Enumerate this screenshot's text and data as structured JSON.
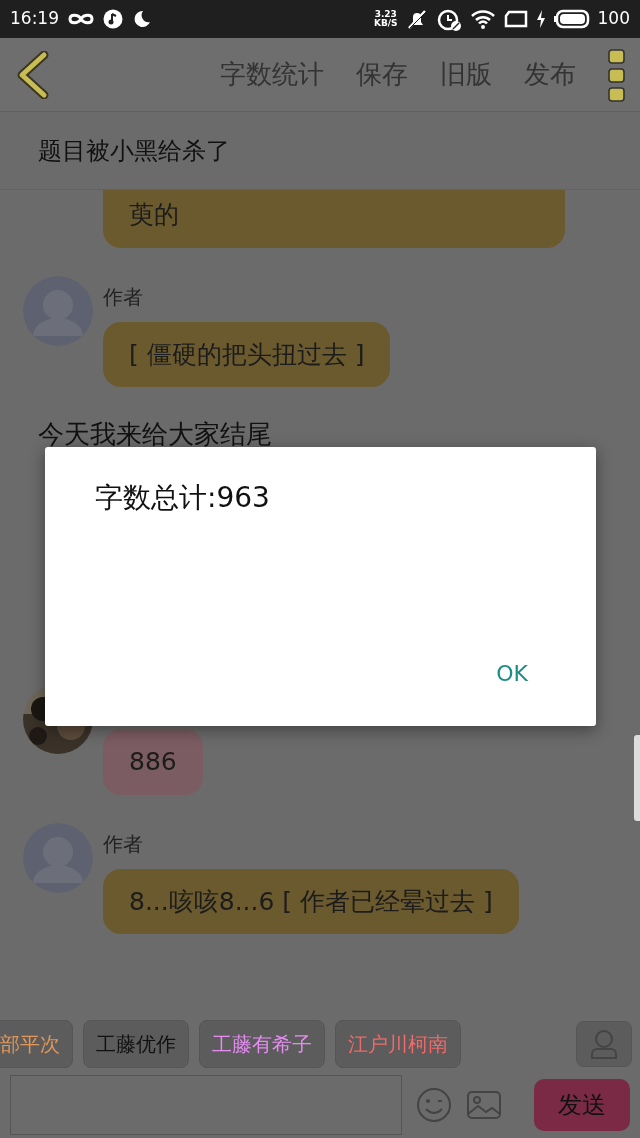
{
  "status_bar": {
    "time": "16:19",
    "speed": "3.23",
    "speed_unit": "KB/S",
    "battery": "100"
  },
  "toolbar": {
    "actions": [
      {
        "label": "字数统计"
      },
      {
        "label": "保存"
      },
      {
        "label": "旧版"
      },
      {
        "label": "发布"
      }
    ]
  },
  "title": "题目被小黑给杀了",
  "messages": [
    {
      "kind": "continued",
      "text": "萸的",
      "color": "#6b5a2e"
    },
    {
      "kind": "default_avatar",
      "name": "作者",
      "text": "[ 僵硬的把头扭过去 ]",
      "color": "#6b5a2e"
    },
    {
      "kind": "plain",
      "text": "今天我来给大家结尾"
    },
    {
      "kind": "photo_avatar",
      "text": "886",
      "color": "#7b5c62"
    },
    {
      "kind": "default_avatar",
      "name": "作者",
      "text": "8...咳咳8...6 [ 作者已经晕过去 ]",
      "color": "#6b5a2e"
    }
  ],
  "dialog": {
    "message": "字数总计:963",
    "button": "OK"
  },
  "chips": [
    {
      "label": "部平次",
      "color": "#e0985a"
    },
    {
      "label": "工藤优作",
      "color": "#111111"
    },
    {
      "label": "工藤有希子",
      "color": "#e48cf0"
    },
    {
      "label": "江户川柯南",
      "color": "#f06a6a"
    }
  ],
  "composer": {
    "send": "发送"
  }
}
